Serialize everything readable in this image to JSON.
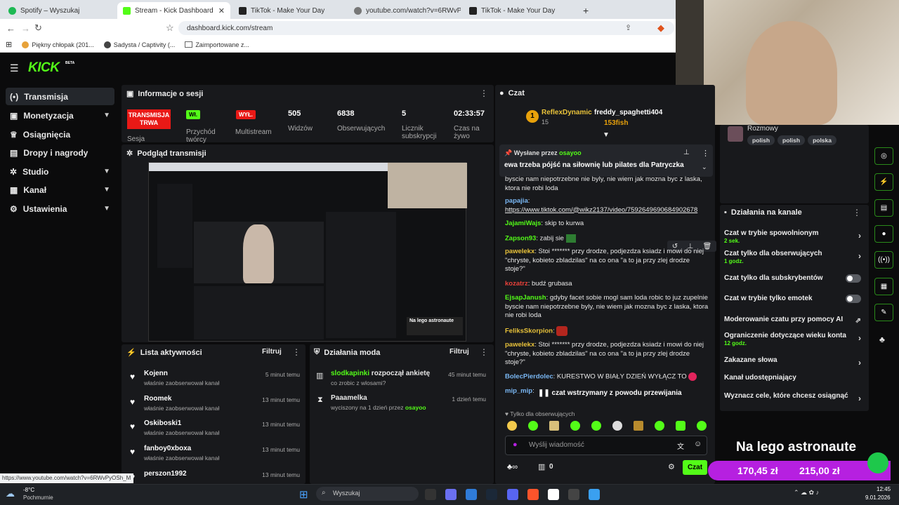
{
  "browser": {
    "tabs": [
      {
        "label": "Spotify – Wyszukaj",
        "color": "#1db954"
      },
      {
        "label": "Stream - Kick Dashboard",
        "color": "#53fc18"
      },
      {
        "label": "TikTok - Make Your Day",
        "color": "#222222"
      },
      {
        "label": "youtube.com/watch?v=6RWvPyOSh_M",
        "color": "#666666"
      },
      {
        "label": "TikTok - Make Your Day",
        "color": "#222222"
      }
    ],
    "url": "dashboard.kick.com/stream",
    "bookmarks": [
      "Piękny chłopak (201...",
      "Sadysta / Captivity (...",
      "Zaimportowane z..."
    ],
    "status_url": "https://www.youtube.com/watch?v=6RWvPyOSh_M"
  },
  "kick": {
    "logo": "KICK",
    "logo_beta": "BETA",
    "sidebar": [
      {
        "label": "Transmisja",
        "icon": "broadcast-icon"
      },
      {
        "label": "Monetyzacja",
        "icon": "money-icon"
      },
      {
        "label": "Osiągnięcia",
        "icon": "trophy-icon"
      },
      {
        "label": "Dropy i nagrody",
        "icon": "gift-icon"
      },
      {
        "label": "Studio",
        "icon": "studio-icon"
      },
      {
        "label": "Kanał",
        "icon": "channel-icon"
      },
      {
        "label": "Ustawienia",
        "icon": "gear-icon"
      }
    ],
    "session": {
      "title": "Informacje o sesji",
      "live_badge": "TRANSMISJA TRWA",
      "live_label": "Sesja",
      "inflow_badge": "Wł.",
      "inflow_label": "Przychód twórcy",
      "multistream_badge": "WYŁ.",
      "multistream_label": "Multistream",
      "viewers_value": "505",
      "viewers_label": "Widzów",
      "followers_value": "6838",
      "followers_label": "Obserwujących",
      "subs_value": "5",
      "subs_label": "Licznik subskrypcji",
      "time_value": "02:33:57",
      "time_label": "Czas na żywo"
    },
    "preview": {
      "title": "Podgląd transmisji"
    },
    "activity": {
      "title": "Lista aktywności",
      "filter": "Filtruj",
      "rows": [
        {
          "name": "Kojenn",
          "sub": "właśnie zaobserwował kanał",
          "time": "5 minut temu"
        },
        {
          "name": "Roomek",
          "sub": "właśnie zaobserwował kanał",
          "time": "13 minut temu"
        },
        {
          "name": "Oskiboski1",
          "sub": "właśnie zaobserwował kanał",
          "time": "13 minut temu"
        },
        {
          "name": "fanboy0xboxa",
          "sub": "właśnie zaobserwował kanał",
          "time": "13 minut temu"
        },
        {
          "name": "perszon1992",
          "sub": "",
          "time": "13 minut temu"
        }
      ]
    },
    "modactions": {
      "title": "Działania moda",
      "filter": "Filtruj",
      "rows": [
        {
          "user": "slodkapinki",
          "action": "rozpoczął ankietę",
          "sub": "co zrobic z wlosami?",
          "time": "45 minut temu"
        },
        {
          "user": "Paaamelka",
          "action": "",
          "sub": "wyciszony na 1 dzień przez",
          "by": "osayoo",
          "time": "1 dzień temu"
        }
      ]
    },
    "chat": {
      "title": "Czat",
      "top_user1": "ReflexDynamic",
      "top_user1_amount": "15",
      "top_rank": "1",
      "top_user2": "freddy_spaghetti404",
      "top_user2_amount": "153fish",
      "pinned_by_label": "Wysłane przez",
      "pinned_by_user": "osayoo",
      "pinned_text": "ewa trzeba pójść na siłownię lub pilates dla Patryczka",
      "msg0": "byscie nam niepotrzebne nie byly, nie wiem jak mozna byc z laska, ktora nie robi loda",
      "msg1_user": "papajia",
      "msg1_text": "https://www.tiktok.com/@wikz2137/video/7592649690684902678",
      "msg2_user": "JajamiWajs",
      "msg2_text": "skip to kurwa",
      "msg3_user": "Zapson93",
      "msg3_text": "zabij sie",
      "msg4_user": "pawelekx",
      "msg4_text": "Stoi ******* przy drodze, podjezdza ksiadz i mowi do niej \"chryste, kobieto zbladzilas\" na co ona \"a to ja przy zlej drodze stoje?\"",
      "msg5_user": "kozatrz",
      "msg5_text": "budź grubasa",
      "msg6_user": "EjsapJanush",
      "msg6_text": "gdyby facet sobie mogl sam loda robic to juz zupelnie byscie nam niepotrzebne byly, nie wiem jak mozna byc z laska, ktora nie robi loda",
      "msg7_user": "FeliksSkorpion",
      "msg8_user": "pawelekx",
      "msg8_text": "Stoi ******* przy drodze, podjezdza ksiadz i mowi do niej \"chryste, kobieto zbladzilas\" na co ona \"a to ja przy zlej drodze stoje?\"",
      "msg9_user": "BolecPierdolec",
      "msg9_text": "KURESTWO W BIAŁY DZIEŃ WYŁĄCZ TO",
      "msg10_user": "mip_mip",
      "paused": "czat wstrzymany z powodu przewijania",
      "followers_only": "Tylko dla obserwujących",
      "input_placeholder": "Wyślij wiadomość",
      "points": "0",
      "send": "Czat"
    },
    "user_card": {
      "label": "Rozmowy",
      "tags": [
        "polish",
        "polish",
        "polska"
      ]
    },
    "channel_actions": {
      "title": "Działania na kanale",
      "rows": [
        {
          "label": "Czat w trybie spowolnionym",
          "sub": "2 sek.",
          "type": "arrow"
        },
        {
          "label": "Czat tylko dla obserwujących",
          "sub": "1 godz.",
          "type": "arrow"
        },
        {
          "label": "Czat tylko dla subskrybentów",
          "sub": "",
          "type": "toggle"
        },
        {
          "label": "Czat w trybie tylko emotek",
          "sub": "",
          "type": "toggle"
        },
        {
          "label": "Moderowanie czatu przy pomocy AI",
          "sub": "",
          "type": "ext"
        },
        {
          "label": "Ograniczenie dotyczące wieku konta",
          "sub": "12 godz.",
          "type": "arrow"
        },
        {
          "label": "Zakazane słowa",
          "sub": "",
          "type": "arrow"
        },
        {
          "label": "Kanał udostępniający",
          "sub": "",
          "type": "none"
        },
        {
          "label": "Wyznacz cele, które chcesz osiągnąć",
          "sub": "",
          "type": "arrow"
        }
      ]
    },
    "overlay": {
      "title": "Na lego astronaute",
      "amount1": "170,45 zł",
      "amount2": "215,00 zł"
    }
  },
  "taskbar": {
    "weather_temp": "-8°C",
    "weather_desc": "Pochmurnie",
    "search": "Wyszukaj",
    "time": "12:45",
    "date": "9.01.2026"
  },
  "colors": {
    "accent": "#53fc18",
    "live": "#e91916",
    "purple": "#b620e0"
  }
}
